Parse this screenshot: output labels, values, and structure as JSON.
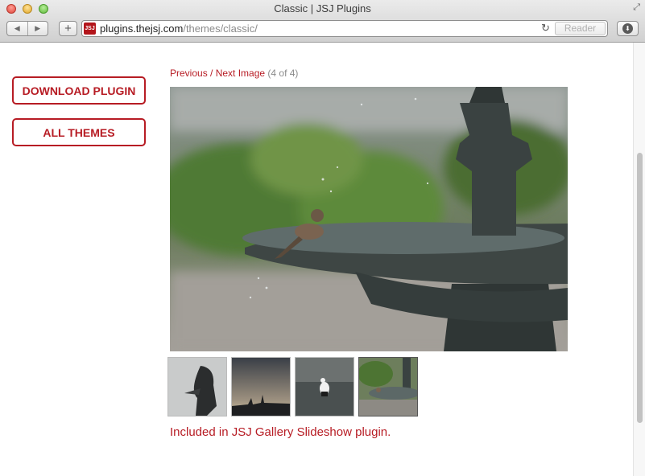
{
  "window": {
    "title": "Classic | JSJ Plugins"
  },
  "toolbar": {
    "back_glyph": "◀",
    "forward_glyph": "▶",
    "new_tab_glyph": "+",
    "favicon_text": "JSJ",
    "url_host": "plugins.thejsj.com",
    "url_path": "/themes/classic/",
    "reload_glyph": "↻",
    "reader_label": "Reader",
    "download_glyph": "⬇",
    "resize_glyph": "⤢"
  },
  "sidebar": {
    "download_label": "DOWNLOAD PLUGIN",
    "themes_label": "ALL THEMES"
  },
  "gallery": {
    "previous_label": "Previous",
    "separator": " / ",
    "next_label": "Next Image",
    "counter": "(4 of 4)",
    "caption": "Included in JSJ Gallery Slideshow plugin.",
    "thumbnails": [
      {
        "subject": "bird statue"
      },
      {
        "subject": "city skyline at dusk"
      },
      {
        "subject": "bird on water"
      },
      {
        "subject": "sparrow on fountain",
        "active": true
      }
    ]
  },
  "colors": {
    "accent": "#b71c24"
  }
}
